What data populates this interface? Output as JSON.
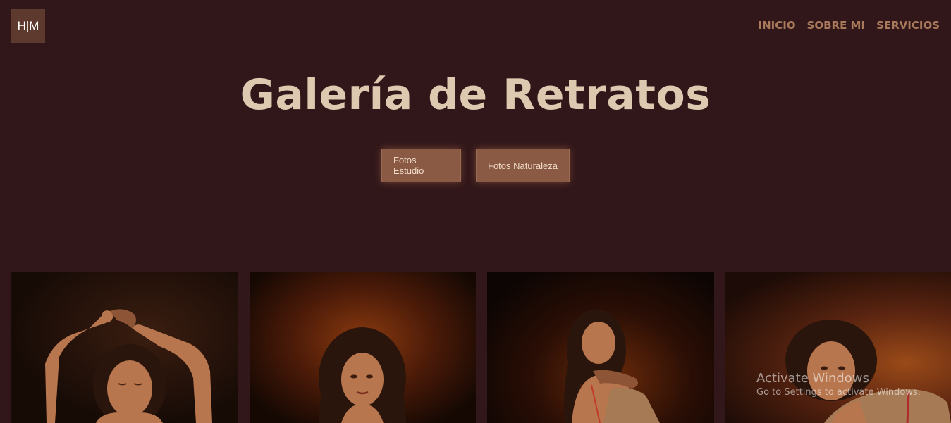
{
  "header": {
    "logo_text": "H|M",
    "nav": [
      {
        "label": "INICIO"
      },
      {
        "label": "SOBRE MI"
      },
      {
        "label": "SERVICIOS"
      }
    ]
  },
  "hero": {
    "title": "Galería de Retratos",
    "buttons": [
      {
        "label": "Fotos Estudio"
      },
      {
        "label": "Fotos Naturaleza"
      }
    ]
  },
  "gallery": {
    "photos": [
      {
        "subject": "studio portrait, arms raised, eyes closed"
      },
      {
        "subject": "studio portrait, curly hair, looking aside"
      },
      {
        "subject": "studio portrait, hand on shoulder"
      },
      {
        "subject": "studio portrait, beige coat"
      }
    ]
  },
  "os_watermark": {
    "line1": "Activate Windows",
    "line2": "Go to Settings to activate Windows."
  },
  "colors": {
    "background": "#31171a",
    "logo_bg": "#5e3a2e",
    "nav_text": "#a8795a",
    "title_text": "#ddc9b0",
    "button_bg": "#8b5a44"
  }
}
